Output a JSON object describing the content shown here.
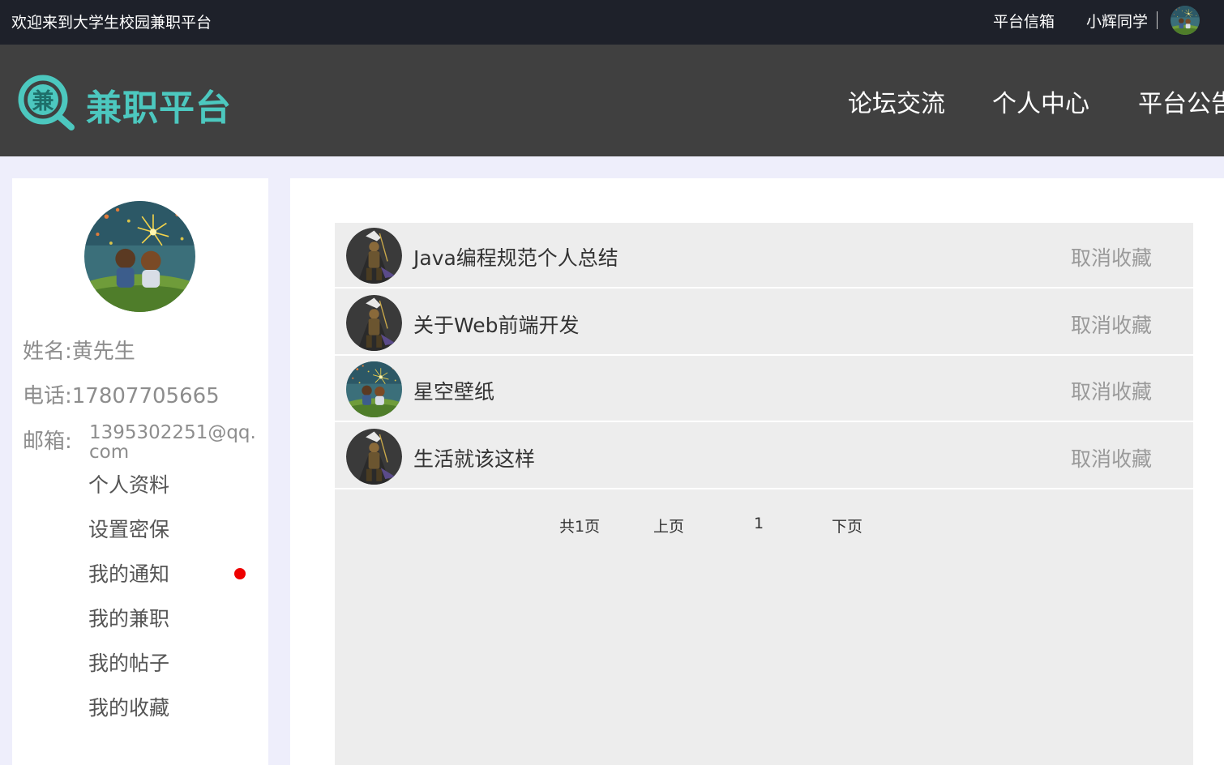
{
  "topbar": {
    "welcome": "欢迎来到大学生校园兼职平台",
    "inbox": "平台信箱",
    "username": "小辉同学"
  },
  "header": {
    "logo_glyph": "兼",
    "logo_text": "兼职平台",
    "nav": [
      "论坛交流",
      "个人中心",
      "平台公告"
    ]
  },
  "profile": {
    "name_label": "姓名:黄先生",
    "phone_label": "电话:17807705665",
    "email_label": "邮箱:",
    "email_value": "1395302251@qq.com"
  },
  "menu": [
    "个人资料",
    "设置密保",
    "我的通知",
    "我的兼职",
    "我的帖子",
    "我的收藏"
  ],
  "favorites": [
    {
      "title": "Java编程规范个人总结",
      "action": "取消收藏",
      "avatar": "warrior-avatar"
    },
    {
      "title": "关于Web前端开发",
      "action": "取消收藏",
      "avatar": "warrior-avatar"
    },
    {
      "title": "星空壁纸",
      "action": "取消收藏",
      "avatar": "fireworks-avatar"
    },
    {
      "title": "生活就该这样",
      "action": "取消收藏",
      "avatar": "warrior-avatar"
    }
  ],
  "pagination": {
    "total": "共1页",
    "prev": "上页",
    "current": "1",
    "next": "下页"
  },
  "colors": {
    "topbar": "#1e212a",
    "header": "#404040",
    "brand": "#4cc8bf",
    "page_bg": "#eeeefb",
    "list_bg": "#ededed",
    "notify_dot": "#ee0000"
  }
}
